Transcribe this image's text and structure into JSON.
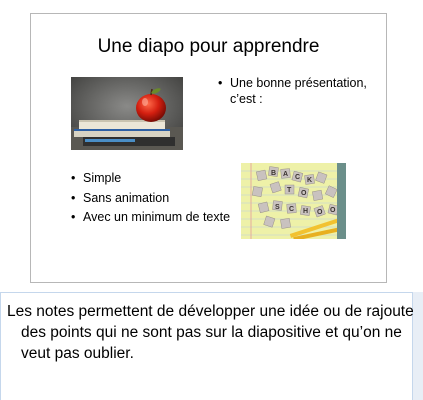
{
  "slide": {
    "title": "Une diapo pour apprendre",
    "right_bullets": [
      "Une bonne présentation, c’est :"
    ],
    "left_bullets": [
      "Simple",
      "Sans  animation",
      "Avec un minimum de texte"
    ]
  },
  "notes": {
    "text": "Les notes permettent de développer une idée ou de rajouter des points qui ne sont pas sur la diapositive et qu’on ne veut pas oublier."
  }
}
